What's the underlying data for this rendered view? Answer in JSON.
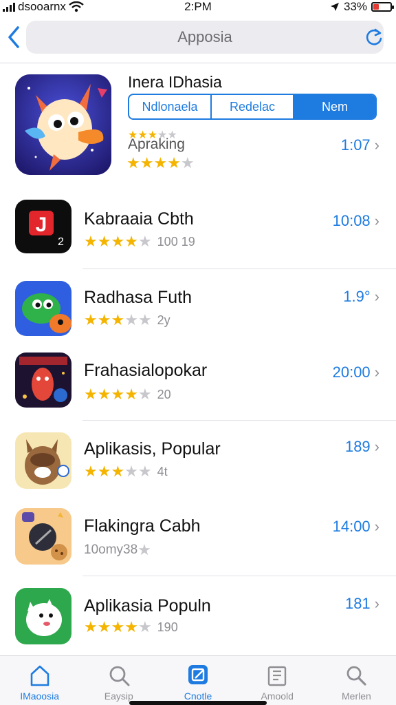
{
  "status": {
    "carrier": "dsooarnx",
    "time": "2:PM",
    "battery": "33%",
    "battery_level": 0.33
  },
  "nav": {
    "search_value": "Apposia"
  },
  "featured": {
    "name": "Inera IDhasia",
    "segments": [
      "Ndlonaela",
      "Redelac",
      "Nem"
    ],
    "subtitle": "Apraking",
    "price": "1:07",
    "rating": 4.5,
    "small_rating": 3
  },
  "apps": [
    {
      "name": "Kabraaia Cbth",
      "price": "10:08",
      "rating": 4,
      "count": "100 19"
    },
    {
      "name": "Radhasa Futh",
      "price": "1.9°",
      "rating": 3.5,
      "count": "2y"
    },
    {
      "name": "Frahasialopokar",
      "price": "20:00",
      "rating": 4,
      "count": "20"
    },
    {
      "name": "Aplikasis, Popular",
      "price": "189",
      "rating": 3.5,
      "count": "4t"
    },
    {
      "name": "Flakingra Cabh",
      "price": "14:00",
      "rating": 0,
      "count": "10omy38"
    },
    {
      "name": "Aplikasia Populn",
      "price": "181",
      "rating": 4,
      "count": "190"
    }
  ],
  "tabs": [
    {
      "label": "IMaoosia",
      "icon": "home-icon",
      "active": true
    },
    {
      "label": "Eaysip",
      "icon": "search-icon",
      "active": false
    },
    {
      "label": "Cnotle",
      "icon": "apps-icon",
      "active": true
    },
    {
      "label": "Amoold",
      "icon": "book-icon",
      "active": false
    },
    {
      "label": "Merlen",
      "icon": "search-icon",
      "active": false
    }
  ],
  "colors": {
    "accent": "#1e7be0",
    "star": "#f4b400",
    "battery": "#e53935"
  }
}
